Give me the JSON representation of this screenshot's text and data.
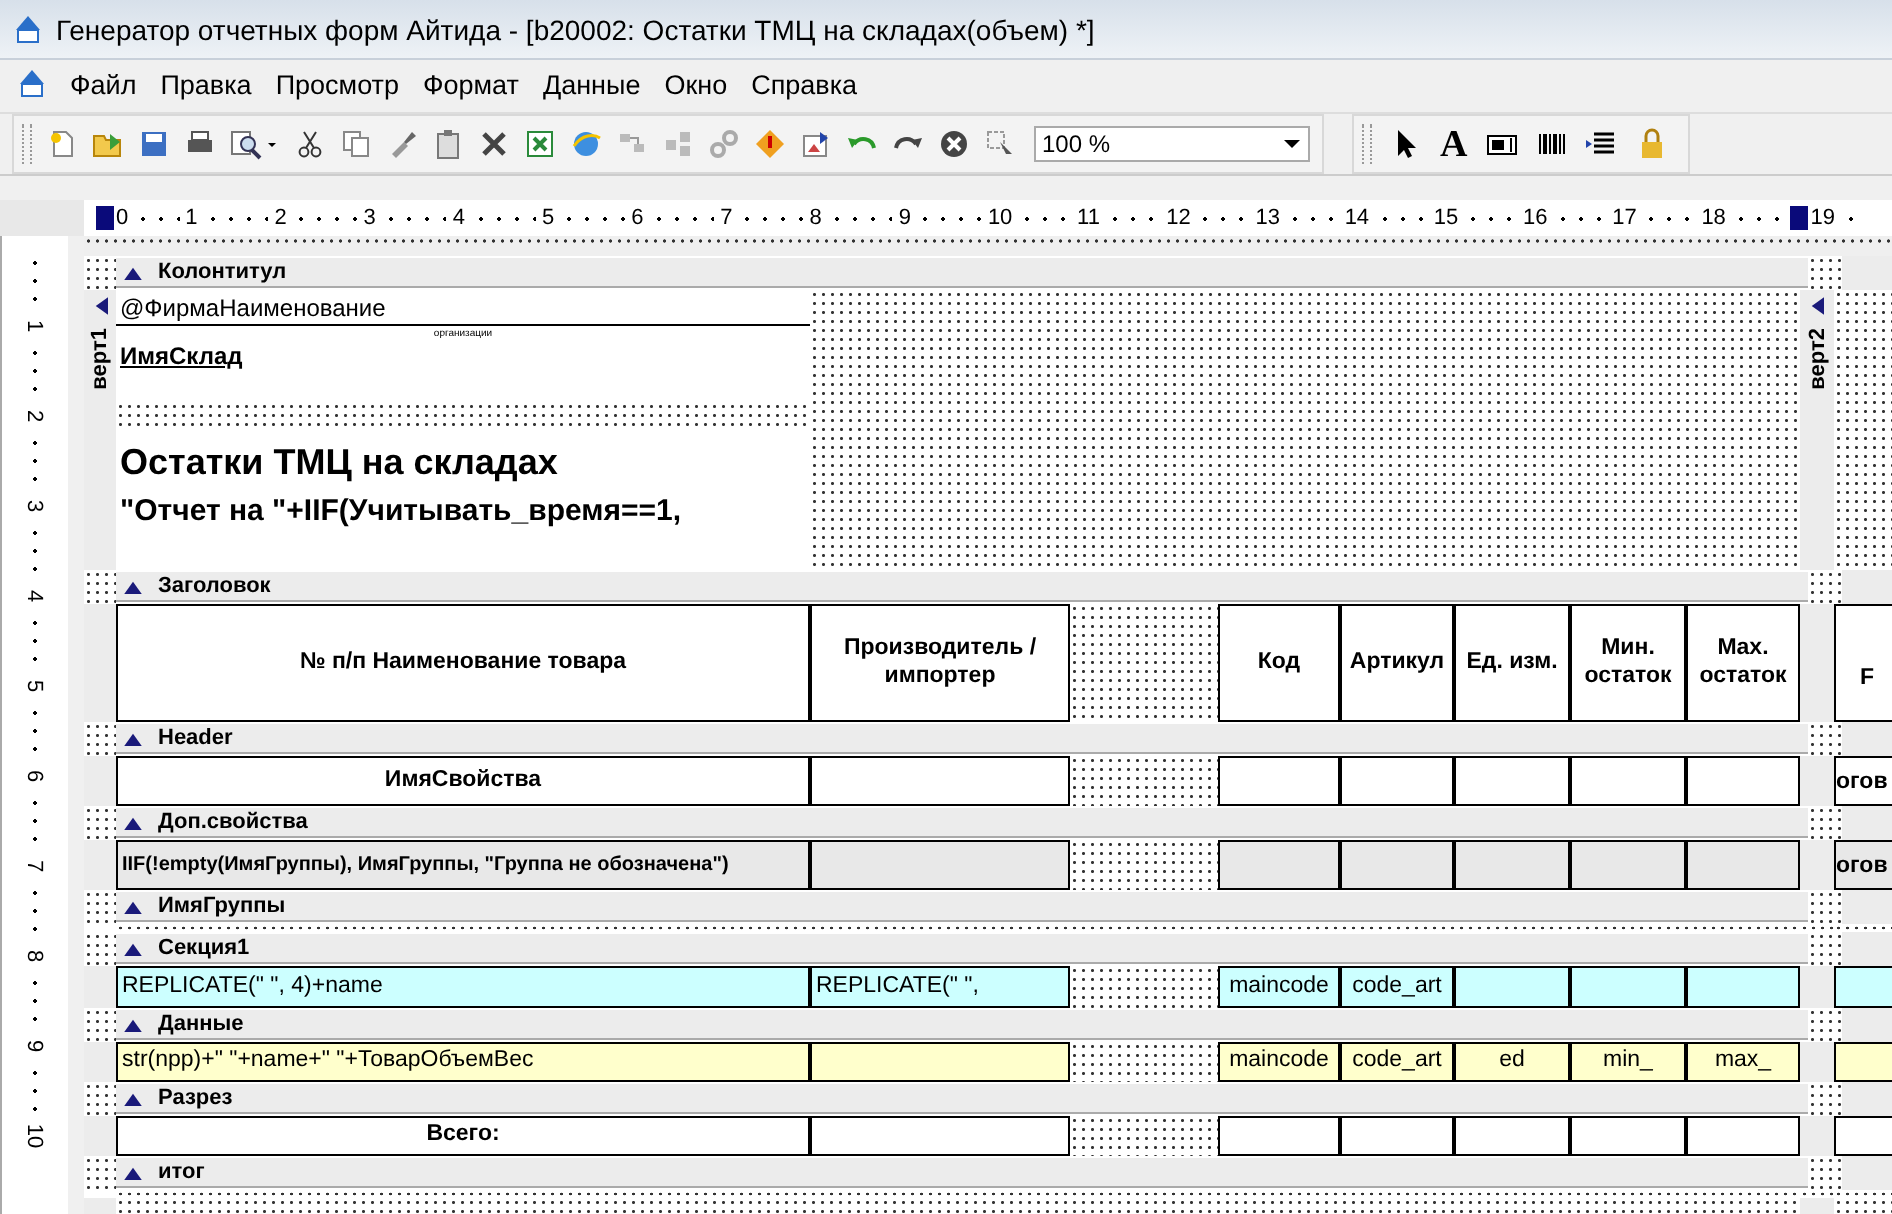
{
  "window": {
    "title": "Генератор отчетных форм Айтида - [b20002: Остатки ТМЦ на складах(объем) *]"
  },
  "menu": [
    "Файл",
    "Правка",
    "Просмотр",
    "Формат",
    "Данные",
    "Окно",
    "Справка"
  ],
  "toolbar": {
    "zoom": "100 %",
    "text_tool": "A"
  },
  "ruler": {
    "marks": [
      "0",
      "1",
      "2",
      "3",
      "4",
      "5",
      "6",
      "7",
      "8",
      "9",
      "10",
      "11",
      "12",
      "13",
      "14",
      "15",
      "16",
      "17",
      "18",
      "19"
    ],
    "vertical_marks": [
      "1",
      "2",
      "3",
      "4",
      "5",
      "6",
      "7",
      "8",
      "9",
      "10"
    ]
  },
  "page_header": {
    "band": "Колонтитул",
    "side_labels": [
      "верт1",
      "верт2"
    ],
    "company_field": "@ФирмаНаименование",
    "company_caption": "организации",
    "warehouse_field": "ИмяСклад",
    "title": "Остатки ТМЦ на складах",
    "date_expression": "\"Отчет на \"+IIF(Учитывать_время==1,"
  },
  "bands": [
    {
      "name": "Заголовок",
      "rows": [
        {
          "kind": "header",
          "cells": [
            "№ п/п Наименование товара",
            "Производитель / импортер",
            "Код",
            "Артикул",
            "Ед. изм.",
            "Мин. остаток",
            "Max. остаток"
          ],
          "far": "F"
        }
      ]
    },
    {
      "name": "Header",
      "rows": [
        {
          "kind": "plain",
          "cells": [
            "ИмяСвойства",
            null,
            null,
            null,
            null,
            null,
            null
          ],
          "far": "огов"
        }
      ]
    },
    {
      "name": "Доп.свойства",
      "rows": [
        {
          "kind": "shaded",
          "cells": [
            "IIF(!empty(ИмяГруппы),  ИмяГруппы, \"Группа не обозначена\")",
            null,
            null,
            null,
            null,
            null,
            null
          ],
          "far": "огов"
        }
      ]
    },
    {
      "name": "ИмяГруппы"
    },
    {
      "name": "Секция1",
      "rows": [
        {
          "kind": "section",
          "cells": [
            "REPLICATE(\" \", 4)+name",
            "REPLICATE(\" \",",
            "maincode",
            "code_art",
            null,
            null,
            null
          ],
          "far": null
        }
      ]
    },
    {
      "name": "Данные",
      "rows": [
        {
          "kind": "data",
          "cells": [
            "str(npp)+\"    \"+name+\"  \"+ТоварОбъемВес",
            null,
            "maincode",
            "code_art",
            "ed",
            "min_",
            "max_"
          ],
          "far": null
        }
      ]
    },
    {
      "name": "Разрез",
      "rows": [
        {
          "kind": "total",
          "cells": [
            "Всего:",
            null,
            null,
            null,
            null,
            null,
            null
          ],
          "far": null
        }
      ]
    },
    {
      "name": "итог"
    }
  ]
}
